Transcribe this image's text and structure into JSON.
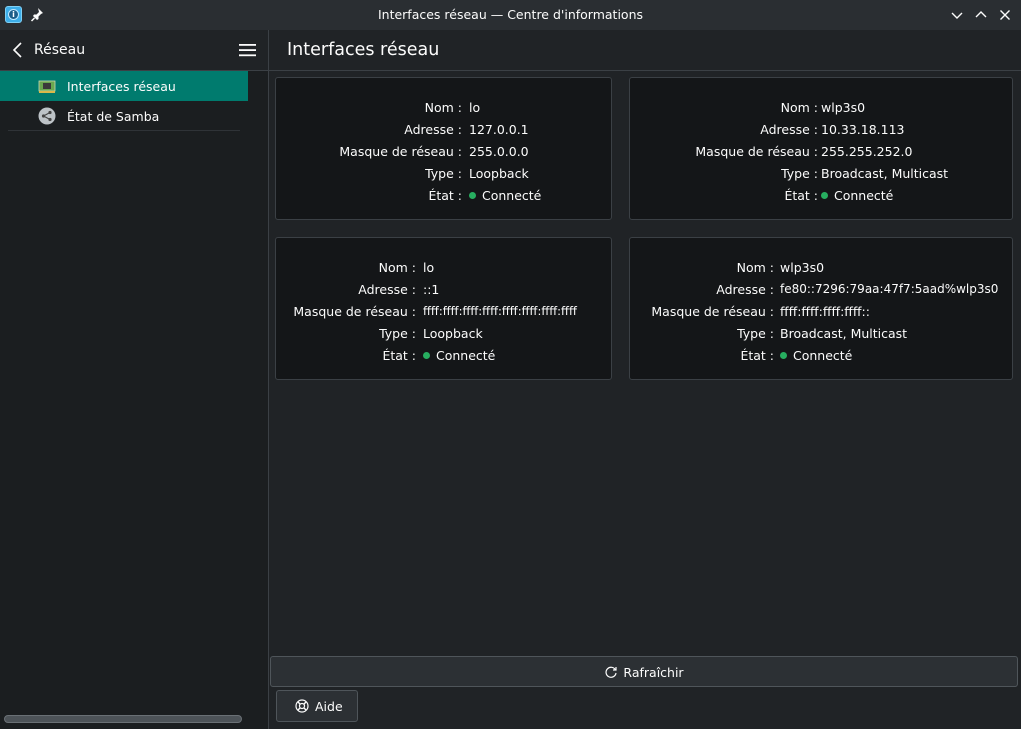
{
  "window": {
    "title": "Interfaces réseau — Centre d'informations",
    "icons": [
      "app-info-icon",
      "pin-icon",
      "minimize-icon",
      "maximize-icon",
      "close-icon"
    ]
  },
  "sidebar": {
    "title": "Réseau",
    "items": [
      {
        "label": "Interfaces réseau",
        "icon": "network-card-icon",
        "selected": true
      },
      {
        "label": "État de Samba",
        "icon": "share-icon",
        "selected": false
      }
    ]
  },
  "main": {
    "title": "Interfaces réseau",
    "labels": {
      "name": "Nom :",
      "address": "Adresse :",
      "netmask": "Masque de réseau :",
      "type": "Type :",
      "state": "État :"
    },
    "interfaces": [
      {
        "name": "lo",
        "address": "127.0.0.1",
        "netmask": "255.0.0.0",
        "type": "Loopback",
        "state": "Connecté"
      },
      {
        "name": "wlp3s0",
        "address": "10.33.18.113",
        "netmask": "255.255.252.0",
        "type": "Broadcast, Multicast",
        "state": "Connecté"
      },
      {
        "name": "lo",
        "address": "::1",
        "netmask": "ffff:ffff:ffff:ffff:ffff:ffff:ffff:ffff",
        "type": "Loopback",
        "state": "Connecté"
      },
      {
        "name": "wlp3s0",
        "address": "fe80::7296:79aa:47f7:5aad%wlp3s0",
        "netmask": "ffff:ffff:ffff:ffff::",
        "type": "Broadcast, Multicast",
        "state": "Connecté"
      }
    ],
    "state_color": "#27ae60",
    "refresh_label": "Rafraîchir",
    "help_label": "Aide"
  },
  "colors": {
    "accent": "#007b6e",
    "background": "#202326",
    "card": "#141618"
  }
}
